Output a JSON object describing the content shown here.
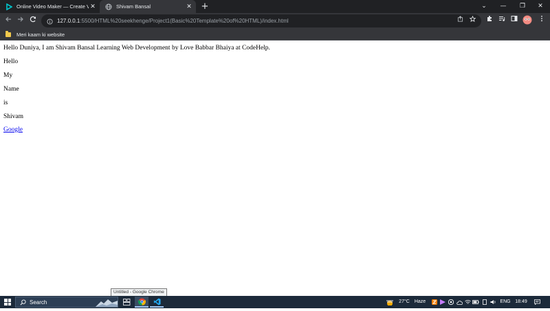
{
  "browser": {
    "tabs": [
      {
        "title": "Online Video Maker — Create Vi",
        "icon": "video-maker-icon",
        "close": "✕"
      },
      {
        "title": "Shivam Bansal",
        "icon": "globe-icon",
        "close": "✕"
      }
    ],
    "new_tab": "+",
    "window_controls": [
      "⌄",
      "—",
      "❐",
      "✕"
    ],
    "address_host": "127.0.0.1",
    "address_path": ":5500/HTML%20seekhenge/Project1(Basic%20Template%20of%20HTML)/index.html",
    "bookmark": "Meri kaam ki website",
    "accent_color": "#f9ab00"
  },
  "page": {
    "heading_text": "Hello Duniya, I am Shivam Bansal Learning Web Development by Love Babbar Bhaiya at CodeHelp.",
    "lines": [
      "Hello",
      "My",
      "Name",
      "is",
      "Shivam"
    ],
    "link_text": "Google"
  },
  "tooltip": "Untitled - Google Chrome",
  "taskbar": {
    "search_label": "Search",
    "temperature": "27°C",
    "weather": "Haze",
    "language": "ENG",
    "time": "18:49"
  }
}
